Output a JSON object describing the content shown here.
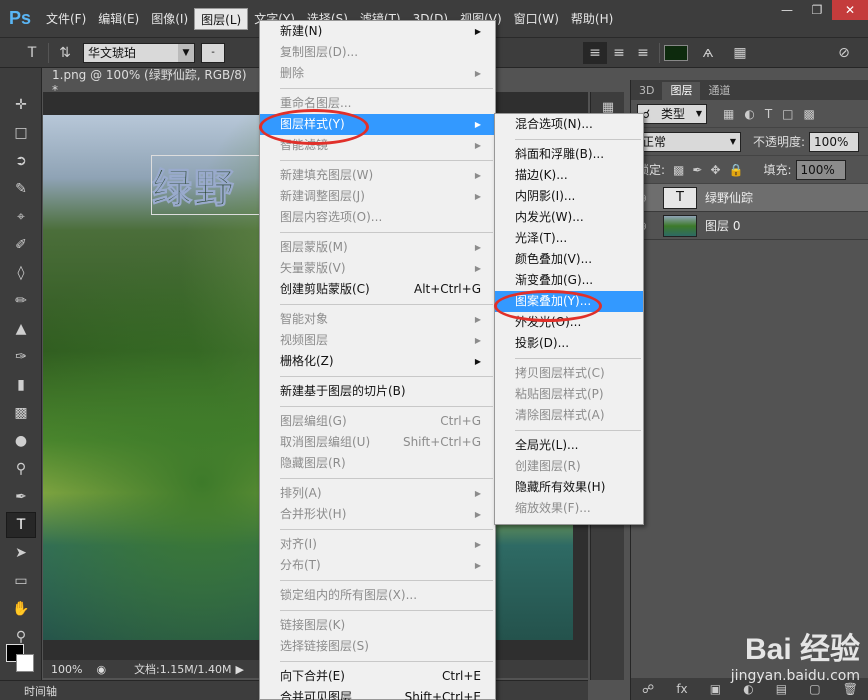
{
  "app": {
    "logo": "Ps"
  },
  "menubar": {
    "items": [
      "文件(F)",
      "编辑(E)",
      "图像(I)",
      "图层(L)",
      "文字(Y)",
      "选择(S)",
      "滤镜(T)",
      "3D(D)",
      "视图(V)",
      "窗口(W)",
      "帮助(H)"
    ],
    "active_index": 3
  },
  "optionsbar": {
    "font_family": "华文琥珀"
  },
  "document": {
    "tab_title": "1.png @ 100% (绿野仙踪, RGB/8) *",
    "canvas_text": "绿野",
    "zoom": "100%",
    "doc_info": "文档:1.15M/1.40M"
  },
  "timeline": {
    "label": "时间轴"
  },
  "layers_panel": {
    "tabs": [
      "3D",
      "图层",
      "通道"
    ],
    "active_tab": 1,
    "filter_kind": "类型",
    "blend_mode": "正常",
    "opacity_label": "不透明度:",
    "opacity_value": "100%",
    "lock_label": "锁定:",
    "fill_label": "填充:",
    "fill_value": "100%",
    "layers": [
      {
        "name": "绿野仙踪",
        "type": "text",
        "thumb": "T",
        "selected": true
      },
      {
        "name": "图层 0",
        "type": "image",
        "selected": false
      }
    ]
  },
  "layer_menu": {
    "items": [
      {
        "label": "新建(N)",
        "submenu": true,
        "disabled": false
      },
      {
        "label": "复制图层(D)...",
        "disabled": true
      },
      {
        "label": "删除",
        "submenu": true,
        "disabled": true
      },
      {
        "sep": true
      },
      {
        "label": "重命名图层...",
        "disabled": true
      },
      {
        "label": "图层样式(Y)",
        "submenu": true,
        "highlight": true
      },
      {
        "label": "智能滤镜",
        "submenu": true,
        "disabled": true
      },
      {
        "sep": true
      },
      {
        "label": "新建填充图层(W)",
        "submenu": true,
        "disabled": true
      },
      {
        "label": "新建调整图层(J)",
        "submenu": true,
        "disabled": true
      },
      {
        "label": "图层内容选项(O)...",
        "disabled": true
      },
      {
        "sep": true
      },
      {
        "label": "图层蒙版(M)",
        "submenu": true,
        "disabled": true
      },
      {
        "label": "矢量蒙版(V)",
        "submenu": true,
        "disabled": true
      },
      {
        "label": "创建剪贴蒙版(C)",
        "shortcut": "Alt+Ctrl+G",
        "disabled": false
      },
      {
        "sep": true
      },
      {
        "label": "智能对象",
        "submenu": true,
        "disabled": true
      },
      {
        "label": "视频图层",
        "submenu": true,
        "disabled": true
      },
      {
        "label": "栅格化(Z)",
        "submenu": true,
        "disabled": false
      },
      {
        "sep": true
      },
      {
        "label": "新建基于图层的切片(B)",
        "disabled": false
      },
      {
        "sep": true
      },
      {
        "label": "图层编组(G)",
        "shortcut": "Ctrl+G",
        "disabled": true
      },
      {
        "label": "取消图层编组(U)",
        "shortcut": "Shift+Ctrl+G",
        "disabled": true
      },
      {
        "label": "隐藏图层(R)",
        "disabled": true
      },
      {
        "sep": true
      },
      {
        "label": "排列(A)",
        "submenu": true,
        "disabled": true
      },
      {
        "label": "合并形状(H)",
        "submenu": true,
        "disabled": true
      },
      {
        "sep": true
      },
      {
        "label": "对齐(I)",
        "submenu": true,
        "disabled": true
      },
      {
        "label": "分布(T)",
        "submenu": true,
        "disabled": true
      },
      {
        "sep": true
      },
      {
        "label": "锁定组内的所有图层(X)...",
        "disabled": true
      },
      {
        "sep": true
      },
      {
        "label": "链接图层(K)",
        "disabled": true
      },
      {
        "label": "选择链接图层(S)",
        "disabled": true
      },
      {
        "sep": true
      },
      {
        "label": "向下合并(E)",
        "shortcut": "Ctrl+E",
        "disabled": false
      },
      {
        "label": "合并可见图层",
        "shortcut": "Shift+Ctrl+E",
        "disabled": false
      }
    ]
  },
  "style_menu": {
    "items": [
      {
        "label": "混合选项(N)...",
        "disabled": false
      },
      {
        "sep": true
      },
      {
        "label": "斜面和浮雕(B)...",
        "disabled": false
      },
      {
        "label": "描边(K)...",
        "disabled": false
      },
      {
        "label": "内阴影(I)...",
        "disabled": false
      },
      {
        "label": "内发光(W)...",
        "disabled": false
      },
      {
        "label": "光泽(T)...",
        "disabled": false
      },
      {
        "label": "颜色叠加(V)...",
        "disabled": false
      },
      {
        "label": "渐变叠加(G)...",
        "disabled": false
      },
      {
        "label": "图案叠加(Y)...",
        "disabled": false,
        "highlight": true
      },
      {
        "label": "外发光(O)...",
        "disabled": false
      },
      {
        "label": "投影(D)...",
        "disabled": false
      },
      {
        "sep": true
      },
      {
        "label": "拷贝图层样式(C)",
        "disabled": true
      },
      {
        "label": "粘贴图层样式(P)",
        "disabled": true
      },
      {
        "label": "清除图层样式(A)",
        "disabled": true
      },
      {
        "sep": true
      },
      {
        "label": "全局光(L)...",
        "disabled": false
      },
      {
        "label": "创建图层(R)",
        "disabled": true
      },
      {
        "label": "隐藏所有效果(H)",
        "disabled": false
      },
      {
        "label": "缩放效果(F)...",
        "disabled": true
      }
    ]
  },
  "watermark": {
    "logo": "Bai 经验",
    "url": "jingyan.baidu.com"
  },
  "colors": {
    "highlight": "#3399ff",
    "annotation": "#e0302a"
  }
}
